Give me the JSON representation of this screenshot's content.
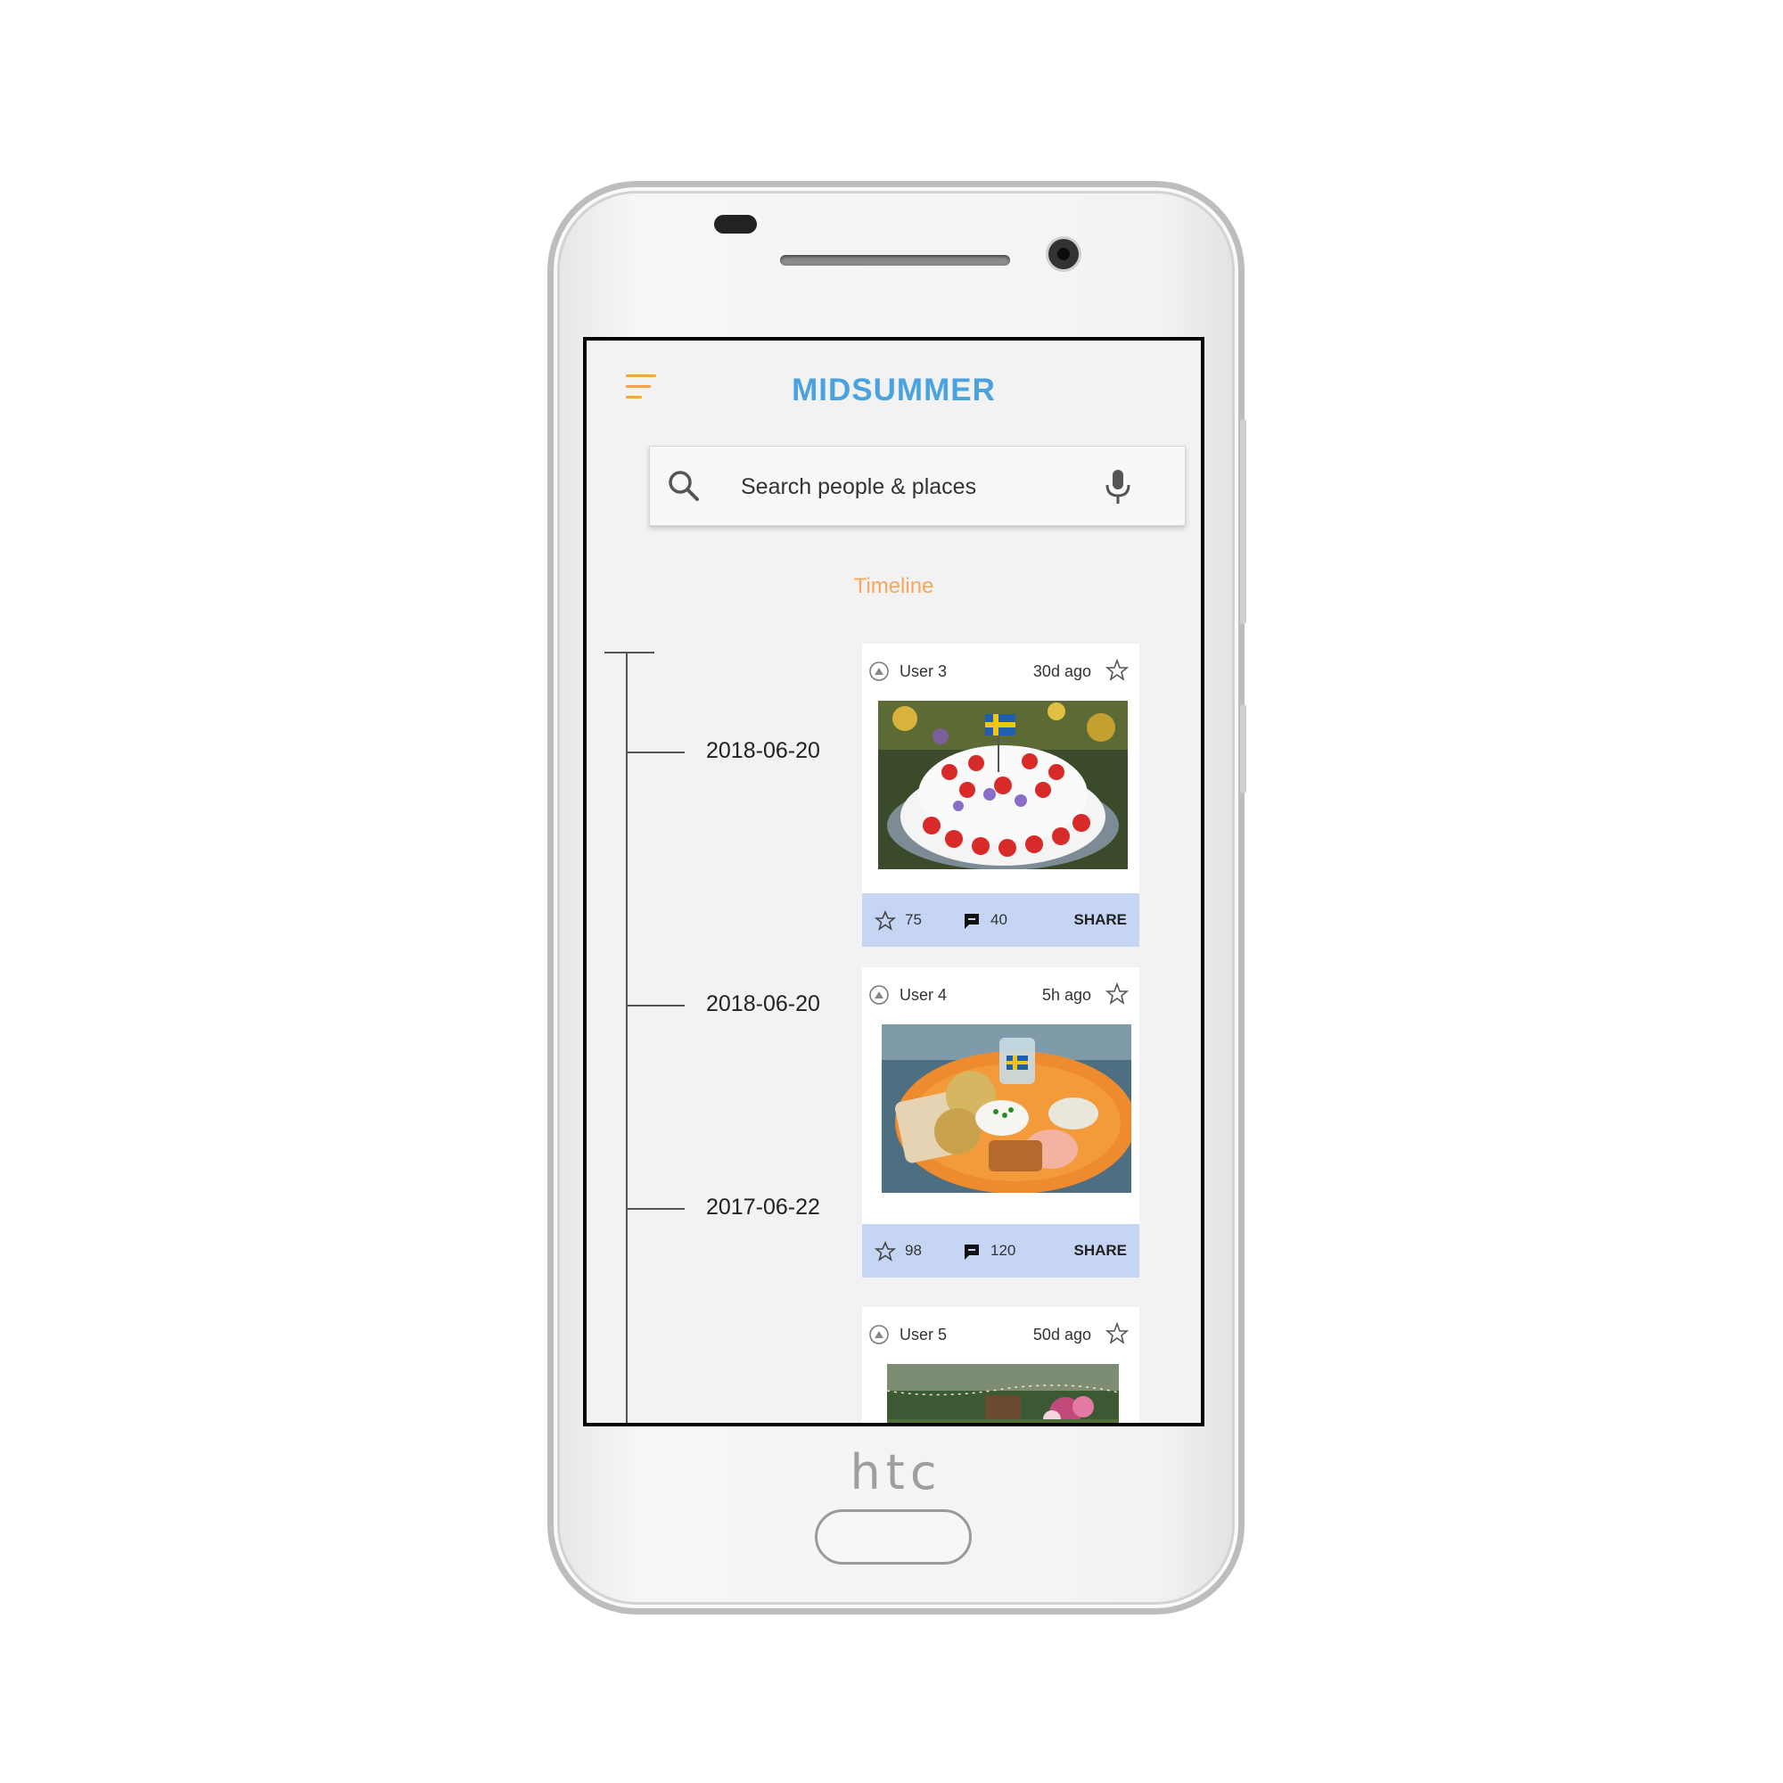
{
  "device": {
    "brand": "htc"
  },
  "app": {
    "title": "MIDSUMMER",
    "accent_color": "#4aa3df",
    "highlight_color": "#f5a85b"
  },
  "search": {
    "placeholder": "Search people & places"
  },
  "timeline": {
    "title": "Timeline",
    "entries": [
      {
        "date": "2018-06-20",
        "user": "User 3",
        "time_ago": "30d ago",
        "likes": "75",
        "comments": "40",
        "share_label": "SHARE",
        "photo": "strawberry-cake-with-swedish-flag"
      },
      {
        "date": "2018-06-20",
        "user": "User 4",
        "time_ago": "5h ago",
        "likes": "98",
        "comments": "120",
        "share_label": "SHARE",
        "photo": "herring-plate-with-potatoes"
      },
      {
        "date": "2017-06-22",
        "user": "User 5",
        "time_ago": "50d ago",
        "photo": "garden-party-scene"
      }
    ]
  },
  "icons": {
    "menu": "menu-icon",
    "search": "search-icon",
    "mic": "microphone-icon",
    "avatar": "user-avatar-icon",
    "favorite": "star-icon",
    "like": "star-icon",
    "comment": "comment-icon"
  },
  "footer_color": "#c5d5f3"
}
